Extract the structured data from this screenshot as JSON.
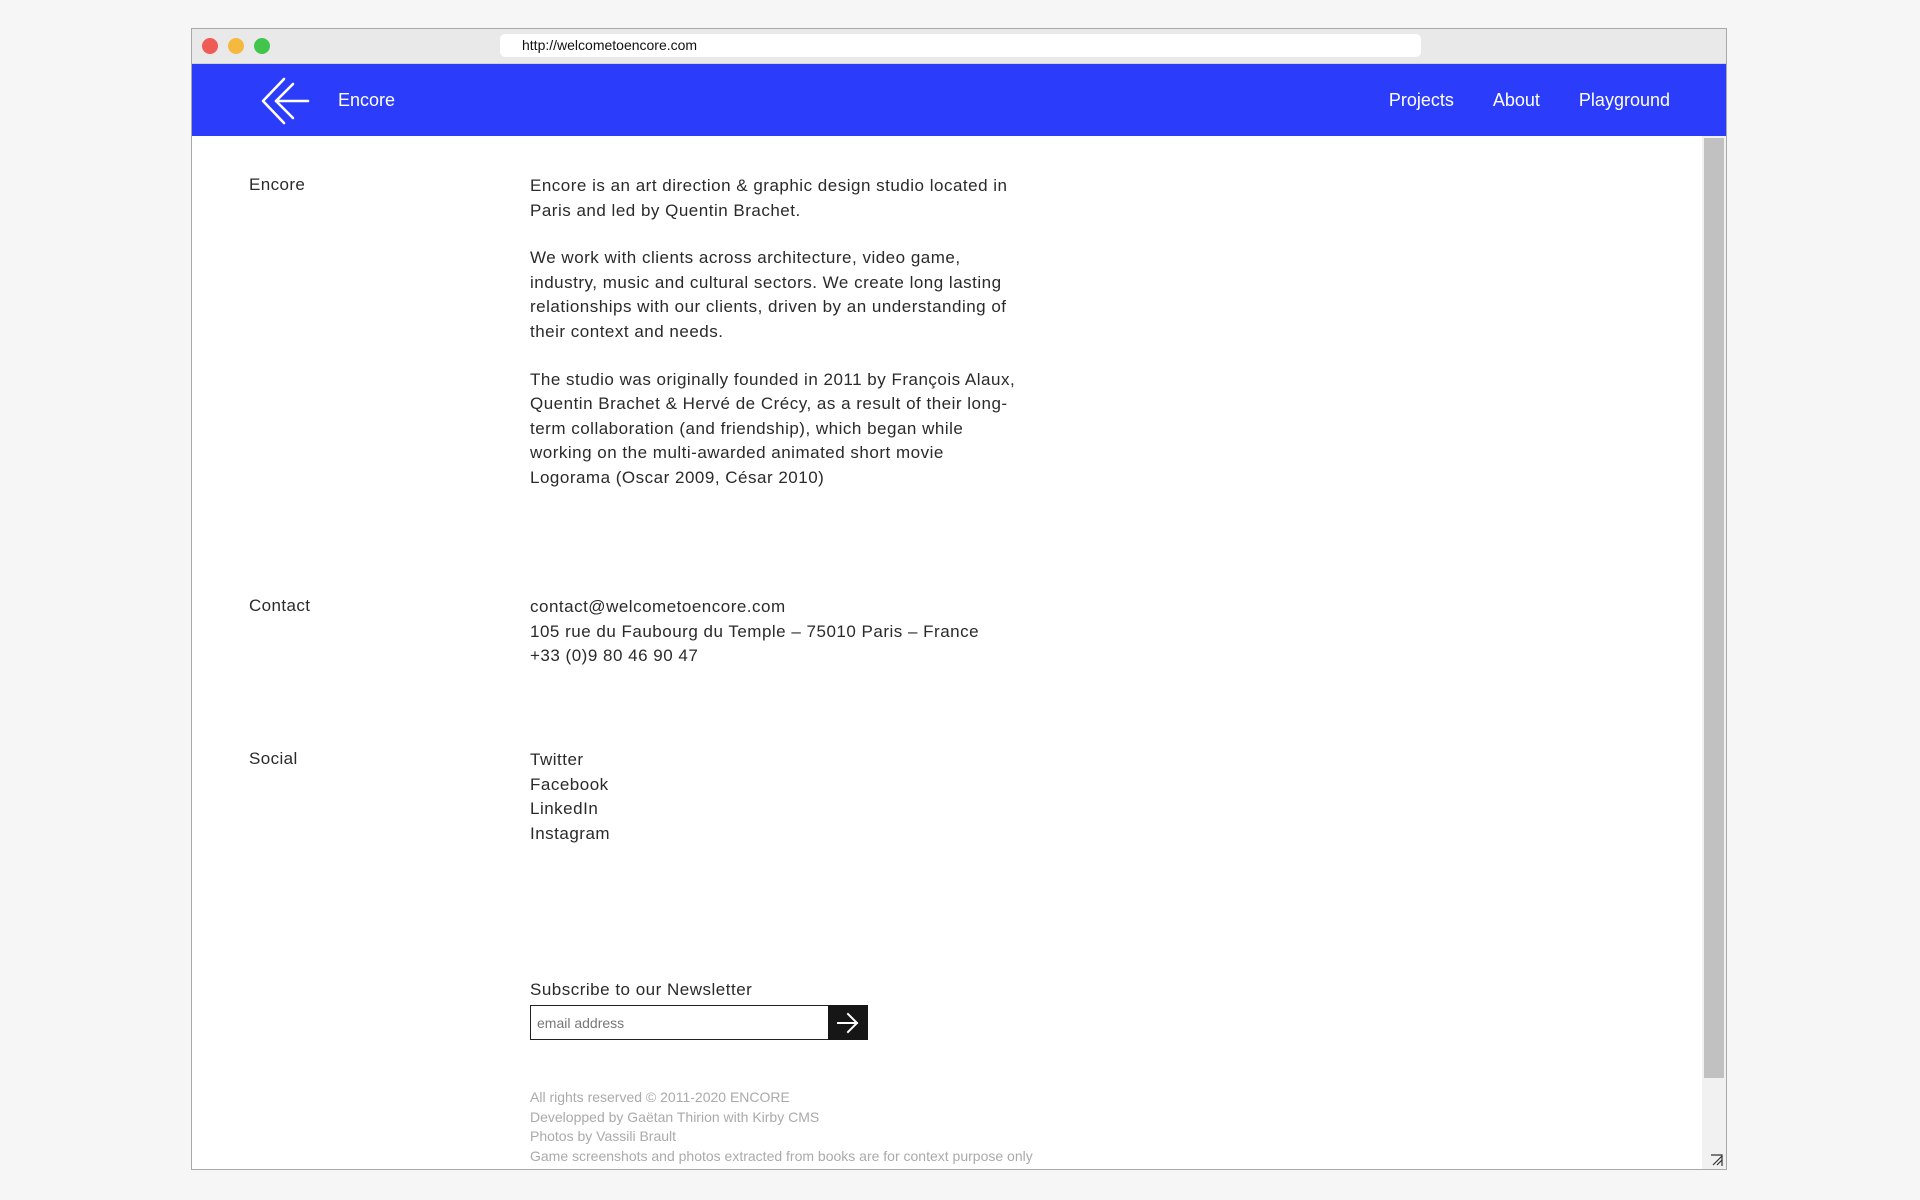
{
  "browser": {
    "url": "http://welcometoencore.com"
  },
  "nav": {
    "brand": "Encore",
    "links": [
      "Projects",
      "About",
      "Playground"
    ]
  },
  "about": {
    "label": "Encore",
    "paragraphs": [
      [
        "Encore is an art direction & graphic design studio located in",
        "Paris and led by Quentin Brachet."
      ],
      [
        "We work with clients across architecture, video game,",
        "industry, music and cultural sectors. We create long lasting",
        "relationships with our clients, driven by an understanding of",
        "their context and needs."
      ],
      [
        "The studio was originally founded in 2011 by François Alaux,",
        "Quentin Brachet & Hervé de Crécy, as a result of their long-",
        "term collaboration (and friendship), which began while",
        "working on the multi-awarded animated short movie",
        "Logorama (Oscar 2009, César 2010)"
      ]
    ]
  },
  "contact": {
    "label": "Contact",
    "email": "contact@welcometoencore.com",
    "address": "105 rue du Faubourg du Temple – 75010 Paris – France",
    "phone": "+33 (0)9 80 46 90 47"
  },
  "social": {
    "label": "Social",
    "links": [
      "Twitter",
      "Facebook",
      "LinkedIn",
      "Instagram"
    ]
  },
  "newsletter": {
    "title": "Subscribe to our Newsletter",
    "placeholder": "email address",
    "value": "",
    "submit_icon": "arrow-right-icon"
  },
  "footer": {
    "lines": [
      "All rights reserved © 2011-2020 ENCORE",
      "Developped by Gaëtan Thirion with Kirby CMS",
      "Photos by Vassili Brault",
      "Game screenshots and photos extracted from books are for context purpose only"
    ]
  },
  "colors": {
    "nav_background": "#2c3cfb",
    "text": "#2a2a2a",
    "footer_text": "#aaaaaa",
    "button": "#161616"
  }
}
